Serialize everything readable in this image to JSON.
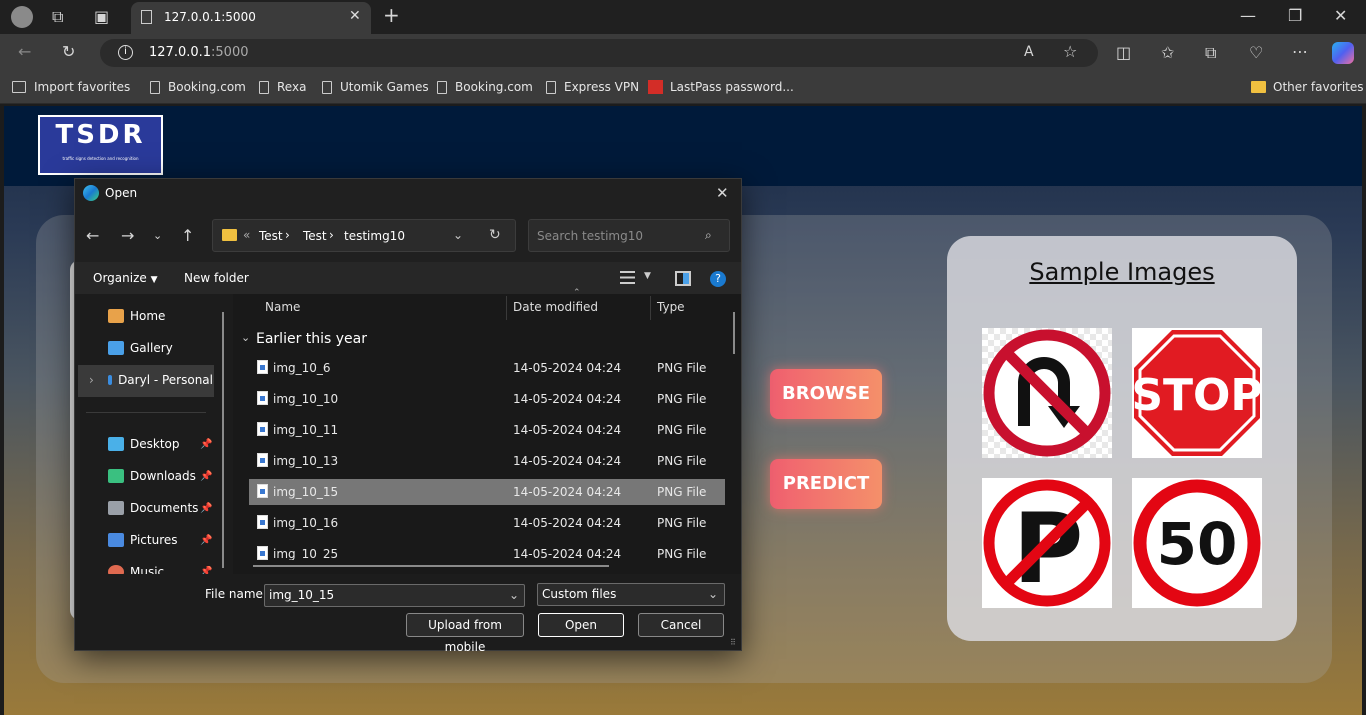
{
  "browser": {
    "tab_title": "127.0.0.1:5000",
    "url_host": "127.0.0.1",
    "url_port": ":5000",
    "favorites": [
      "Import favorites",
      "Booking.com",
      "Rexa",
      "Utomik Games",
      "Booking.com",
      "Express VPN",
      "LastPass password..."
    ],
    "other_favorites": "Other favorites"
  },
  "app": {
    "logo_text": "TSDR",
    "logo_subtitle": "traffic signs detection and recognition",
    "browse_label": "BROWSE",
    "predict_label": "PREDICT",
    "samples_title": "Sample Images",
    "sample_signs": [
      {
        "name": "no-u-turn-sign"
      },
      {
        "name": "stop-sign",
        "text": "STOP"
      },
      {
        "name": "no-parking-sign",
        "text": "P"
      },
      {
        "name": "speed-limit-sign",
        "text": "50"
      }
    ]
  },
  "dialog": {
    "title": "Open",
    "path": [
      "Test",
      "Test",
      "testimg10"
    ],
    "search_placeholder": "Search testimg10",
    "organize": "Organize",
    "new_folder": "New folder",
    "nav_items": [
      {
        "label": "Home",
        "icon": "home-icon",
        "color": "#e8a24a",
        "pinned": false
      },
      {
        "label": "Gallery",
        "icon": "gallery-icon",
        "color": "#4aa0e8",
        "pinned": false
      },
      {
        "label": "Daryl - Personal",
        "icon": "onedrive-icon",
        "color": "#3a8de0",
        "pinned": false
      },
      {
        "label": "Desktop",
        "icon": "desktop-icon",
        "color": "#4ab0e8",
        "pinned": true
      },
      {
        "label": "Downloads",
        "icon": "download-icon",
        "color": "#3ac080",
        "pinned": true
      },
      {
        "label": "Documents",
        "icon": "documents-icon",
        "color": "#9aa0a8",
        "pinned": true
      },
      {
        "label": "Pictures",
        "icon": "pictures-icon",
        "color": "#4a8ae0",
        "pinned": true
      },
      {
        "label": "Music",
        "icon": "music-icon",
        "color": "#e06a50",
        "pinned": true
      }
    ],
    "columns": {
      "name": "Name",
      "date": "Date modified",
      "type": "Type"
    },
    "group_label": "Earlier this year",
    "files": [
      {
        "name": "img_10_6",
        "date": "14-05-2024 04:24",
        "type": "PNG File",
        "selected": false
      },
      {
        "name": "img_10_10",
        "date": "14-05-2024 04:24",
        "type": "PNG File",
        "selected": false
      },
      {
        "name": "img_10_11",
        "date": "14-05-2024 04:24",
        "type": "PNG File",
        "selected": false
      },
      {
        "name": "img_10_13",
        "date": "14-05-2024 04:24",
        "type": "PNG File",
        "selected": false
      },
      {
        "name": "img_10_15",
        "date": "14-05-2024 04:24",
        "type": "PNG File",
        "selected": true
      },
      {
        "name": "img_10_16",
        "date": "14-05-2024 04:24",
        "type": "PNG File",
        "selected": false
      },
      {
        "name": "img_10_25",
        "date": "14-05-2024 04:24",
        "type": "PNG File",
        "selected": false
      }
    ],
    "file_name_label": "File name:",
    "file_name_value": "img_10_15",
    "file_type": "Custom files",
    "upload_mobile": "Upload from mobile",
    "open_label": "Open",
    "cancel_label": "Cancel"
  }
}
